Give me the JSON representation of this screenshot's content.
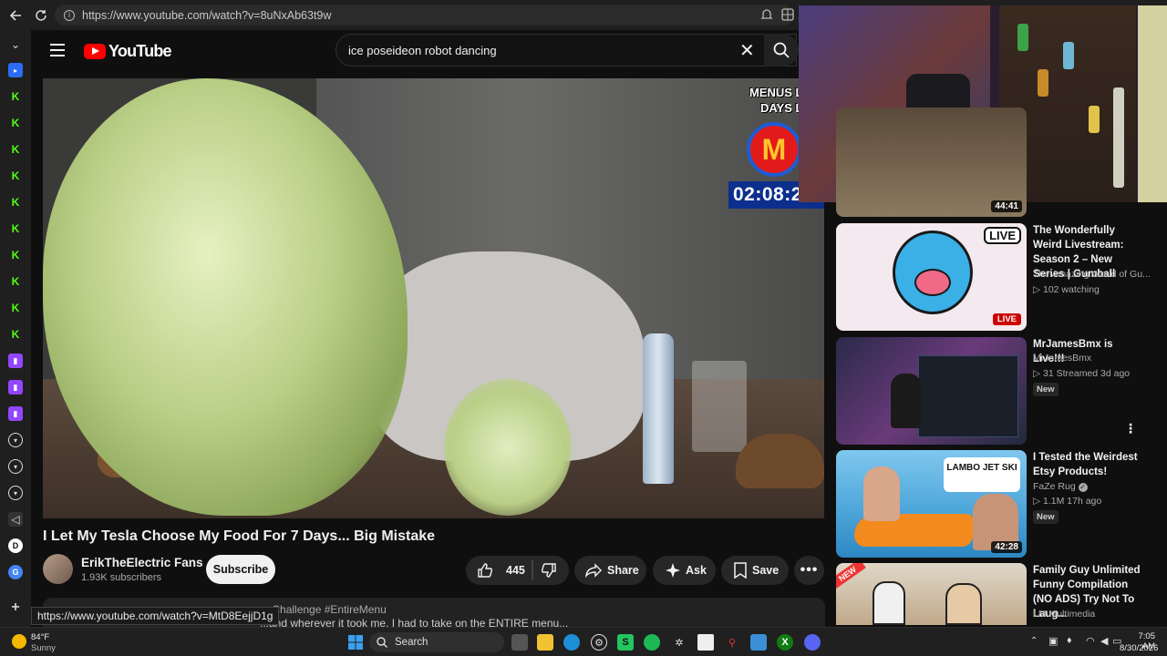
{
  "browser": {
    "url": "https://www.youtube.com/watch?v=8uNxAb63t9w",
    "status_url": "https://www.youtube.com/watch?v=MtD8EejjD1g"
  },
  "youtube": {
    "brand": "YouTube",
    "search_query": "ice poseideon robot dancing"
  },
  "player_overlay": {
    "menus_text": "MENUS LEFT\nDAYS LEFT",
    "logo_letter": "M",
    "timer": "02:08:2"
  },
  "video": {
    "title": "I Let My Tesla Choose My Food For 7 Days... Big Mistake",
    "channel": "ErikTheElectric Fans",
    "subscribers": "1.93K subscribers",
    "subscribe_label": "Subscribe",
    "likes": "445",
    "share_label": "Share",
    "ask_label": "Ask",
    "save_label": "Save",
    "description_snippet": "ngChallenge #EntireMenu",
    "description_line2": "...and wherever it took me, I had to take on the ENTIRE menu..."
  },
  "recommendations": [
    {
      "duration": "44:41"
    },
    {
      "title": "The Wonderfully Weird Livestream: Season 2 – New Series | Gumball",
      "channel": "The Amazing World of Gu...",
      "meta": "102 watching",
      "badge": "LIVE",
      "thumb_badge": "LIVE"
    },
    {
      "title": "MrJamesBmx is Live!!!",
      "channel": "MrJamesBmx",
      "meta": "31  Streamed 3d ago",
      "new": "New"
    },
    {
      "title": "I Tested the Weirdest Etsy Products!",
      "channel": "FaZe Rug",
      "meta": "1.1M  17h ago",
      "new": "New",
      "duration": "42:28",
      "thumb_text": "LAMBO JET SKI"
    },
    {
      "title": "Family Guy Unlimited Funny Compilation (NO ADS) Try Not To Laug...",
      "channel": "LM Multimedia",
      "thumb_text": "NEW"
    }
  ],
  "taskbar": {
    "weather_temp": "84°F",
    "weather_desc": "Sunny",
    "search_label": "Search",
    "time": "7:05 AM",
    "date": "8/30/2026"
  },
  "colors": {
    "youtube_red": "#ff0000",
    "background": "#0f0f0f",
    "pill": "#272727"
  }
}
